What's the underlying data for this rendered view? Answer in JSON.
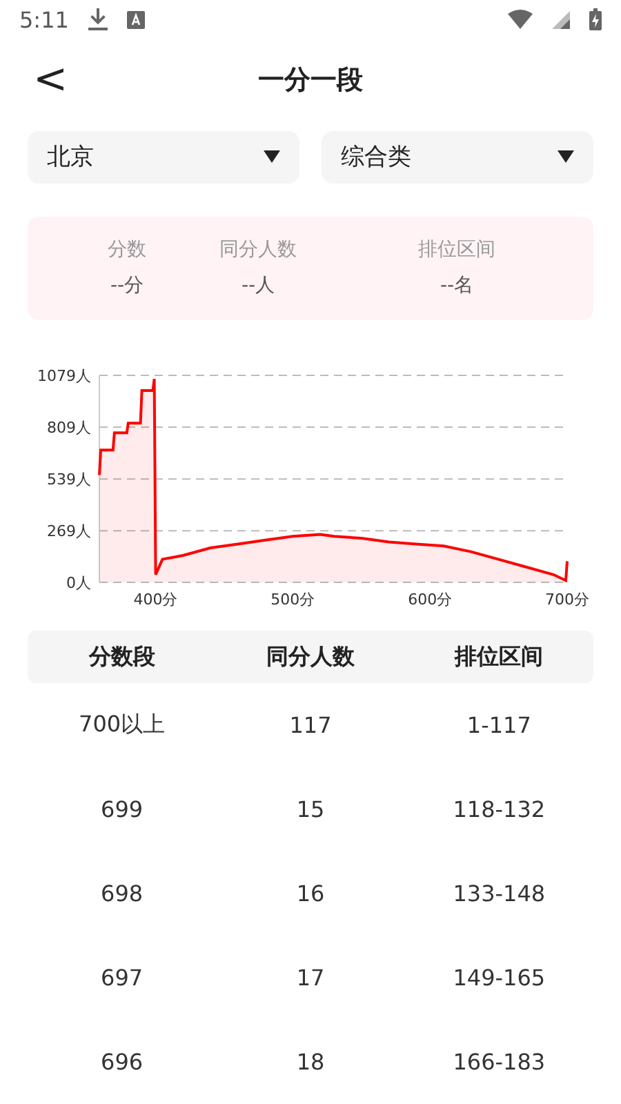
{
  "status_bar": {
    "time": "5:11"
  },
  "header": {
    "back": "<",
    "title": "一分一段"
  },
  "filters": [
    {
      "label": "北京"
    },
    {
      "label": "综合类"
    }
  ],
  "summary": [
    {
      "label": "分数",
      "value": "--分"
    },
    {
      "label": "同分人数",
      "value": "--人"
    },
    {
      "label": "排位区间",
      "value": "--名"
    }
  ],
  "chart_data": {
    "type": "area",
    "x": [
      359,
      360,
      369,
      370,
      379,
      380,
      389,
      390,
      398,
      399,
      400,
      405,
      420,
      440,
      460,
      480,
      500,
      520,
      530,
      550,
      570,
      590,
      610,
      630,
      650,
      670,
      690,
      699,
      700
    ],
    "grid": true,
    "series": [
      {
        "color": "#ff0000",
        "values": [
          560,
          690,
          690,
          780,
          780,
          830,
          830,
          1000,
          1000,
          1060,
          40,
          120,
          140,
          180,
          200,
          220,
          240,
          250,
          240,
          230,
          210,
          200,
          190,
          160,
          120,
          80,
          40,
          10,
          110
        ]
      }
    ],
    "xlim": [
      359,
      700
    ],
    "ylim": [
      0,
      1079
    ],
    "xticks": [
      {
        "value": 400,
        "label": "400分"
      },
      {
        "value": 500,
        "label": "500分"
      },
      {
        "value": 600,
        "label": "600分"
      },
      {
        "value": 700,
        "label": "700分"
      }
    ],
    "yticks": [
      {
        "value": 0,
        "label": "0人"
      },
      {
        "value": 269,
        "label": "269人"
      },
      {
        "value": 539,
        "label": "539人"
      },
      {
        "value": 809,
        "label": "809人"
      },
      {
        "value": 1079,
        "label": "1079人"
      }
    ]
  },
  "table": {
    "columns": [
      "分数段",
      "同分人数",
      "排位区间"
    ],
    "rows": [
      [
        "700以上",
        "117",
        "1-117"
      ],
      [
        "699",
        "15",
        "118-132"
      ],
      [
        "698",
        "16",
        "133-148"
      ],
      [
        "697",
        "17",
        "149-165"
      ],
      [
        "696",
        "18",
        "166-183"
      ]
    ]
  }
}
